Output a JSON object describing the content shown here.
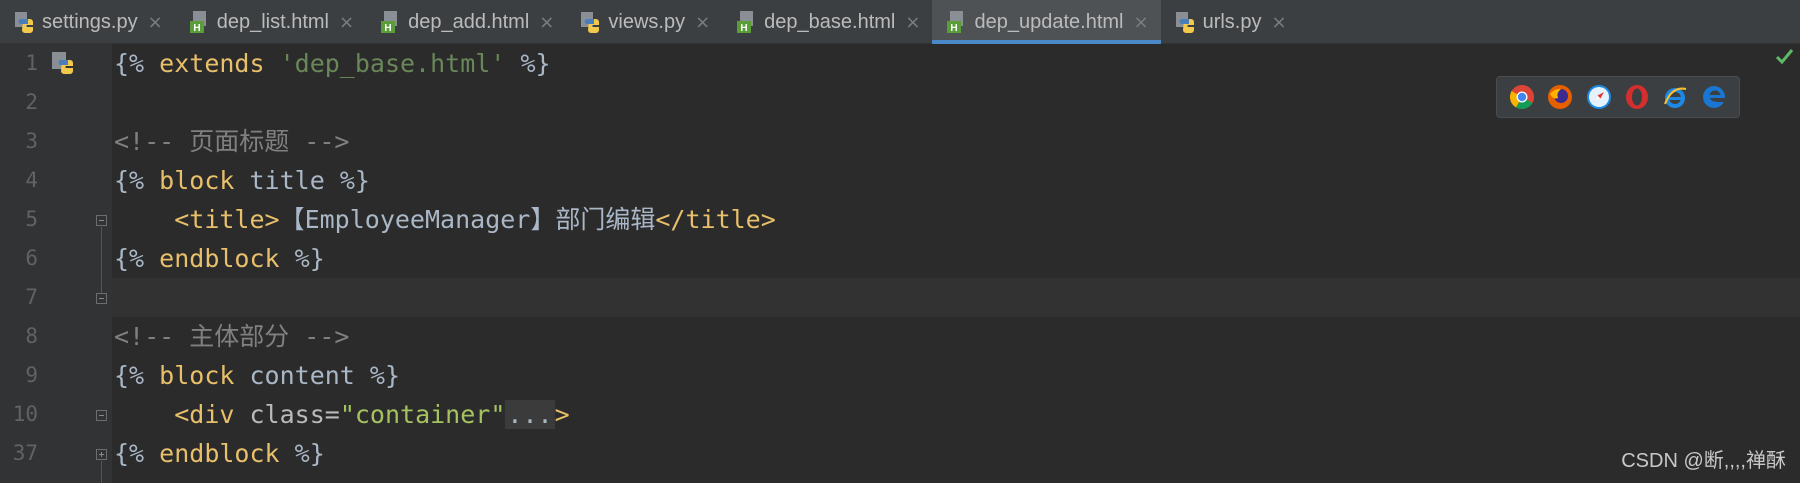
{
  "tabs": [
    {
      "label": "settings.py",
      "type": "python",
      "active": false
    },
    {
      "label": "dep_list.html",
      "type": "html",
      "active": false
    },
    {
      "label": "dep_add.html",
      "type": "html",
      "active": false
    },
    {
      "label": "views.py",
      "type": "python",
      "active": false
    },
    {
      "label": "dep_base.html",
      "type": "html",
      "active": false
    },
    {
      "label": "dep_update.html",
      "type": "html",
      "active": true
    },
    {
      "label": "urls.py",
      "type": "python",
      "active": false
    }
  ],
  "tab_close_glyph": "×",
  "line_numbers": [
    "1",
    "2",
    "3",
    "4",
    "5",
    "6",
    "7",
    "8",
    "9",
    "10",
    "37"
  ],
  "code": {
    "l1": {
      "open": "{%",
      "kw": "extends",
      "str": "'dep_base.html'",
      "close": "%}"
    },
    "l3": {
      "comment": "<!-- 页面标题 -->"
    },
    "l4": {
      "open": "{%",
      "kw": "block",
      "name": "title",
      "close": "%}"
    },
    "l5": {
      "open_tag": "<title>",
      "text": "【EmployeeManager】部门编辑",
      "close_tag": "</title>"
    },
    "l6": {
      "open": "{%",
      "kw": "endblock",
      "close": "%}"
    },
    "l8": {
      "comment": "<!-- 主体部分 -->"
    },
    "l9": {
      "open": "{%",
      "kw": "block",
      "name": "content",
      "close": "%}"
    },
    "l10": {
      "tag_start": "<div",
      "attr": "class",
      "eq": "=",
      "val": "\"container\"",
      "folded": "...",
      "tag_end": ">"
    },
    "l37": {
      "open": "{%",
      "kw": "endblock",
      "close": "%}"
    }
  },
  "browsers": [
    "chrome-icon",
    "firefox-icon",
    "safari-icon",
    "opera-icon",
    "ie-icon",
    "edge-icon"
  ],
  "watermark": "CSDN @断,,,,禅酥",
  "colors": {
    "background": "#2b2b2b",
    "gutter": "#313335",
    "tab_active_underline": "#4a88c7",
    "keyword": "#e8bf6a",
    "string": "#6a8759",
    "comment": "#808080",
    "attr_value": "#a5c261"
  }
}
